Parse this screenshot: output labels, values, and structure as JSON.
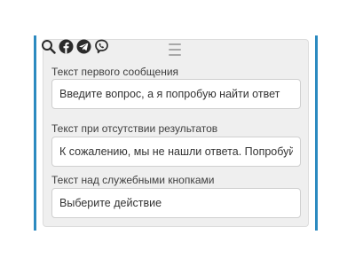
{
  "toolbar": {
    "icons": [
      "search-icon",
      "facebook-icon",
      "telegram-icon",
      "viber-icon"
    ]
  },
  "fields": [
    {
      "label": "Текст первого сообщения",
      "value": "Введите вопрос, а я попробую найти ответ"
    },
    {
      "label": "Текст при отсутствии результатов",
      "value": "К сожалению, мы не нашли ответа. Попробуйте"
    },
    {
      "label": "Текст над служебными кнопками",
      "value": "Выберите действие"
    }
  ],
  "colors": {
    "frame_accent": "#2c8ac0",
    "panel_bg": "#efefef",
    "input_border": "#cfcfcf",
    "icon_dark": "#2b2b2b"
  }
}
